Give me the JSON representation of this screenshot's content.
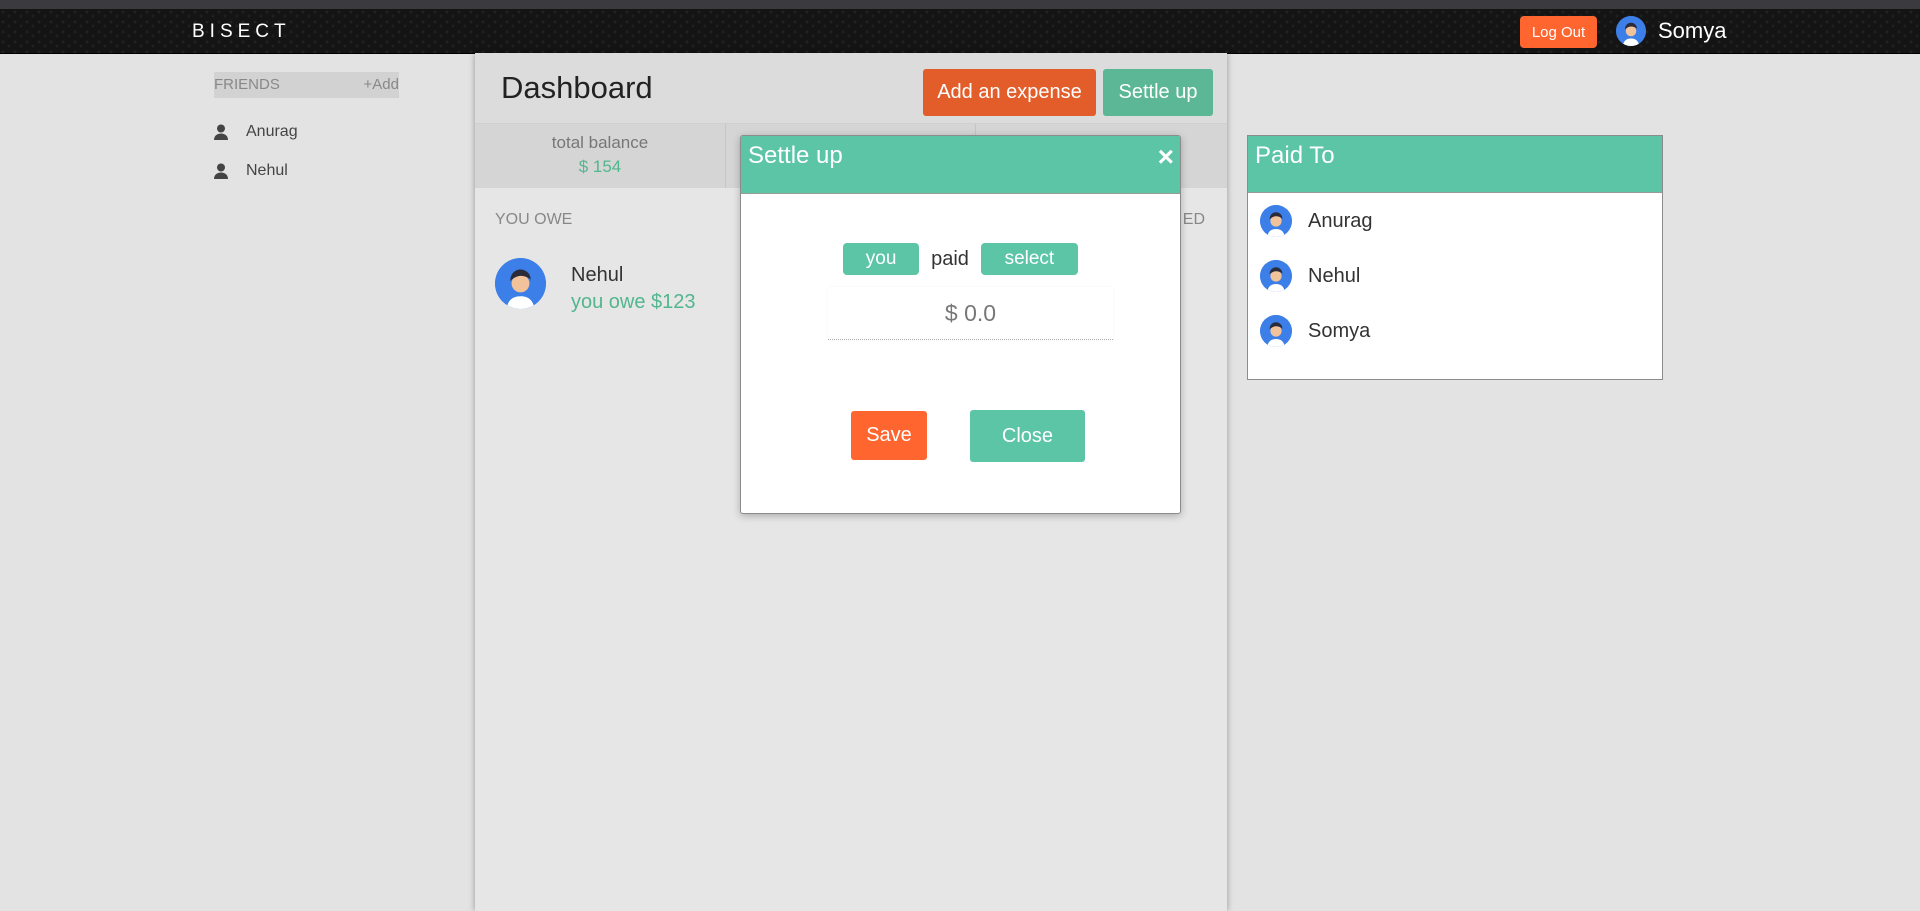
{
  "navbar": {
    "brand": "BISECT",
    "logout_label": "Log Out",
    "user_name": "Somya"
  },
  "sidebar": {
    "friends_label": "FRIENDS",
    "add_label": "+Add",
    "friends": [
      {
        "name": "Anurag",
        "icon": "person-icon"
      },
      {
        "name": "Nehul",
        "icon": "person-icon"
      }
    ]
  },
  "dashboard": {
    "title": "Dashboard",
    "add_expense_label": "Add an expense",
    "settle_up_label": "Settle up",
    "total_balance_label": "total balance",
    "total_balance_value": "$ 154",
    "right_column_partial": "ED",
    "you_owe_heading": "YOU OWE",
    "you_owe": [
      {
        "name": "Nehul",
        "amount_text": "you owe $123"
      }
    ]
  },
  "modal": {
    "title": "Settle up",
    "close_icon": "×",
    "payer_label": "you",
    "paid_word": "paid",
    "payee_label": "select",
    "amount_placeholder": "$ 0.0",
    "save_label": "Save",
    "close_label": "Close"
  },
  "paid_to": {
    "title": "Paid To",
    "people": [
      {
        "name": "Anurag"
      },
      {
        "name": "Nehul"
      },
      {
        "name": "Somya"
      }
    ]
  },
  "colors": {
    "accent_green": "#5cc5a6",
    "accent_orange": "#ff652f",
    "balance_green": "#52b68f"
  }
}
